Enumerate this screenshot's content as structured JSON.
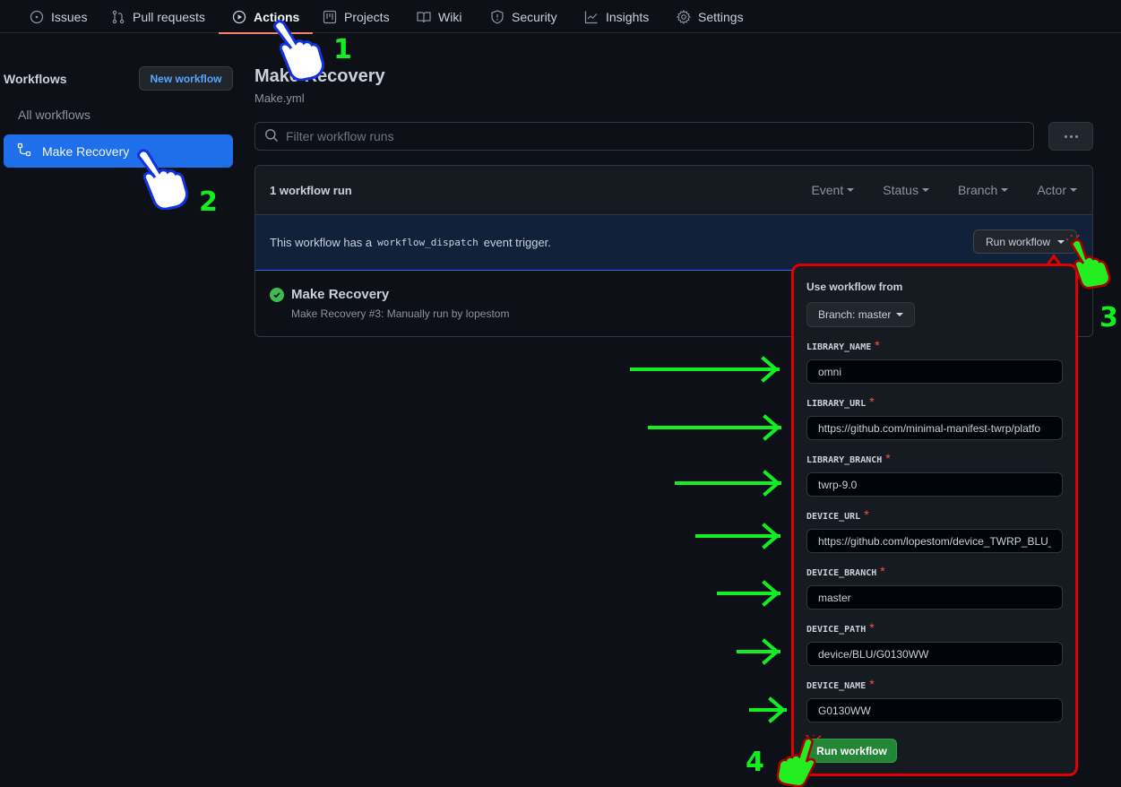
{
  "nav": {
    "items": [
      {
        "label": "Issues",
        "icon": "issue-circle-icon"
      },
      {
        "label": "Pull requests",
        "icon": "pull-request-icon"
      },
      {
        "label": "Actions",
        "icon": "play-circle-icon",
        "active": true
      },
      {
        "label": "Projects",
        "icon": "project-board-icon"
      },
      {
        "label": "Wiki",
        "icon": "book-icon"
      },
      {
        "label": "Security",
        "icon": "shield-icon"
      },
      {
        "label": "Insights",
        "icon": "graph-icon"
      },
      {
        "label": "Settings",
        "icon": "gear-icon"
      }
    ]
  },
  "sidebar": {
    "title": "Workflows",
    "new_workflow": "New workflow",
    "all_workflows": "All workflows",
    "active_workflow": "Make Recovery"
  },
  "main": {
    "title": "Make Recovery",
    "filename": "Make.yml",
    "filter_placeholder": "Filter workflow runs",
    "runs_count": "1 workflow run",
    "filters": [
      "Event",
      "Status",
      "Branch",
      "Actor"
    ],
    "dispatch": {
      "prefix": "This workflow has a",
      "code": "workflow_dispatch",
      "suffix": "event trigger.",
      "button": "Run workflow"
    },
    "runs": [
      {
        "title": "Make Recovery",
        "subtitle": "Make Recovery #3: Manually run by lopestom",
        "status": "success"
      }
    ]
  },
  "panel": {
    "use_from": "Use workflow from",
    "branch_button": "Branch: master",
    "fields": [
      {
        "label": "LIBRARY_NAME",
        "value": "omni"
      },
      {
        "label": "LIBRARY_URL",
        "value": "https://github.com/minimal-manifest-twrp/platfo"
      },
      {
        "label": "LIBRARY_BRANCH",
        "value": "twrp-9.0"
      },
      {
        "label": "DEVICE_URL",
        "value": "https://github.com/lopestom/device_TWRP_BLU_"
      },
      {
        "label": "DEVICE_BRANCH",
        "value": "master"
      },
      {
        "label": "DEVICE_PATH",
        "value": "device/BLU/G0130WW"
      },
      {
        "label": "DEVICE_NAME",
        "value": "G0130WW"
      }
    ],
    "required_mark": "*",
    "submit": "Run workflow"
  },
  "annotations": {
    "steps": [
      "1",
      "2",
      "3",
      "4"
    ],
    "colors": {
      "step_green": "#11ee22",
      "highlight_red": "#e00000",
      "accent_blue": "#1f6feb",
      "success_green": "#238636"
    }
  }
}
